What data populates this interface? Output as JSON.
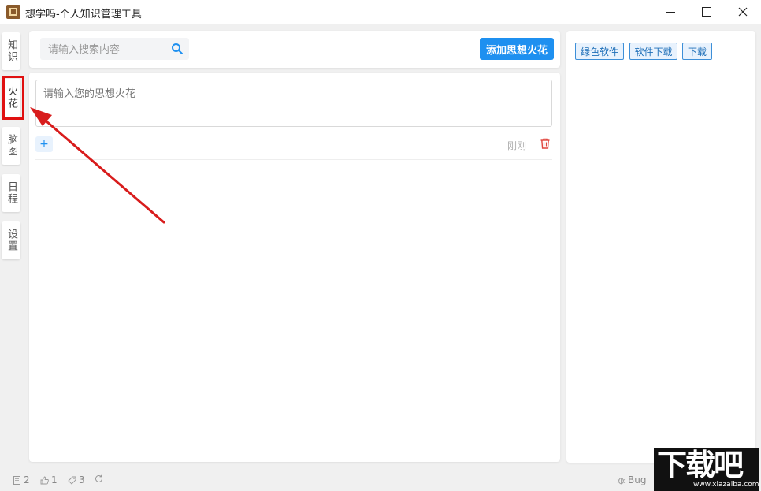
{
  "window": {
    "title": "想学吗-个人知识管理工具"
  },
  "tabs": [
    {
      "label": "知识"
    },
    {
      "label": "火花"
    },
    {
      "label": "脑图"
    },
    {
      "label": "日程"
    },
    {
      "label": "设置"
    }
  ],
  "toolbar": {
    "search_placeholder": "请输入搜索内容",
    "add_label": "添加思想火花"
  },
  "spark": {
    "input_placeholder": "请输入您的思想火花",
    "plus_label": "+",
    "time_label": "刚刚"
  },
  "tags": [
    {
      "label": "绿色软件"
    },
    {
      "label": "软件下载"
    },
    {
      "label": "下载"
    }
  ],
  "status": {
    "docs_count": "2",
    "likes_count": "1",
    "tags_count": "3",
    "bug_label": "Bug"
  },
  "watermark": {
    "text": "下载吧",
    "url": "www.xiazaiba.com"
  },
  "colors": {
    "accent": "#1e90f0",
    "highlight": "#e01010",
    "danger": "#e0443c"
  }
}
